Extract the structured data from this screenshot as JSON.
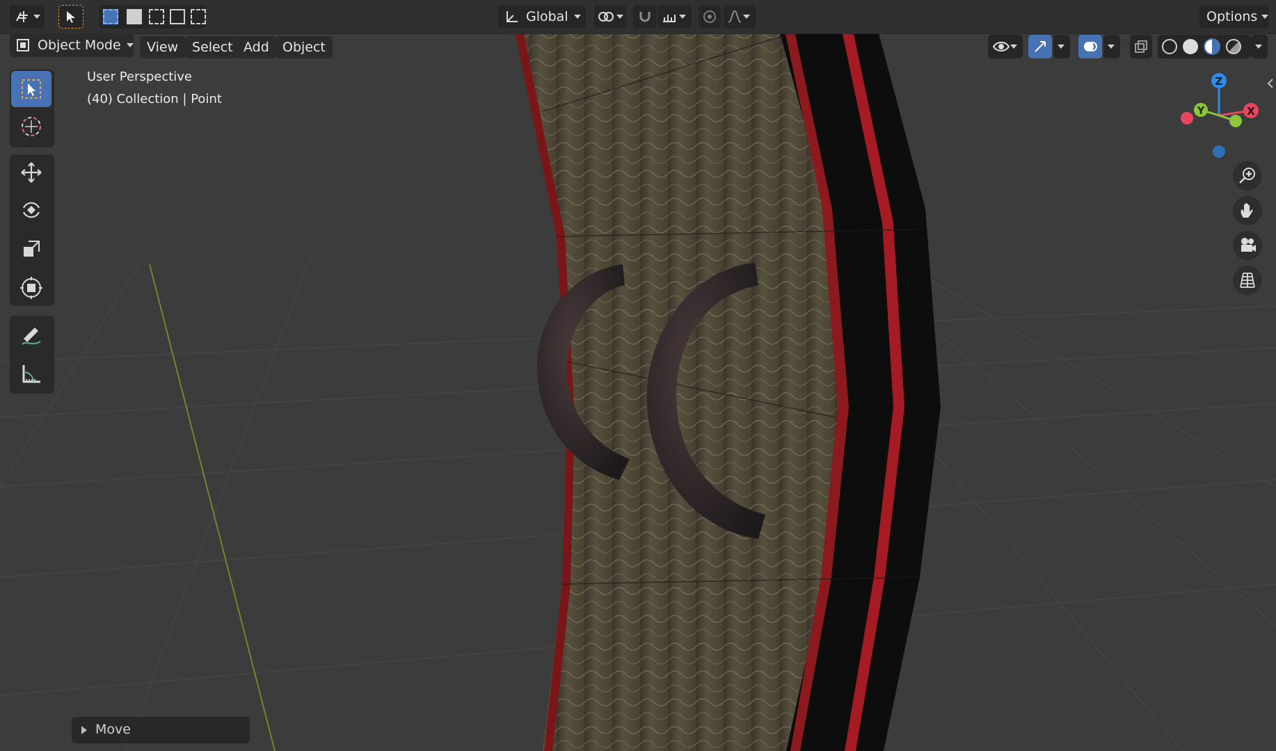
{
  "header": {
    "transform_orientation": "Global",
    "options_label": "Options"
  },
  "menubar": {
    "mode": "Object Mode",
    "items": [
      "View",
      "Select",
      "Add",
      "Object"
    ]
  },
  "viewport": {
    "view_name": "User Perspective",
    "collection_info": "(40) Collection | Point"
  },
  "gizmo": {
    "z": "Z",
    "y": "Y",
    "x": "X"
  },
  "operator_panel": {
    "label": "Move"
  },
  "colors": {
    "accent": "#4772b3",
    "x_axis": "#e8475e",
    "y_axis": "#8cc63f",
    "z_axis": "#2f8be8"
  },
  "tools": [
    "select-box-icon",
    "cursor-icon",
    "move-icon",
    "rotate-icon",
    "scale-icon",
    "transform-icon",
    "annotate-icon",
    "measure-icon"
  ]
}
